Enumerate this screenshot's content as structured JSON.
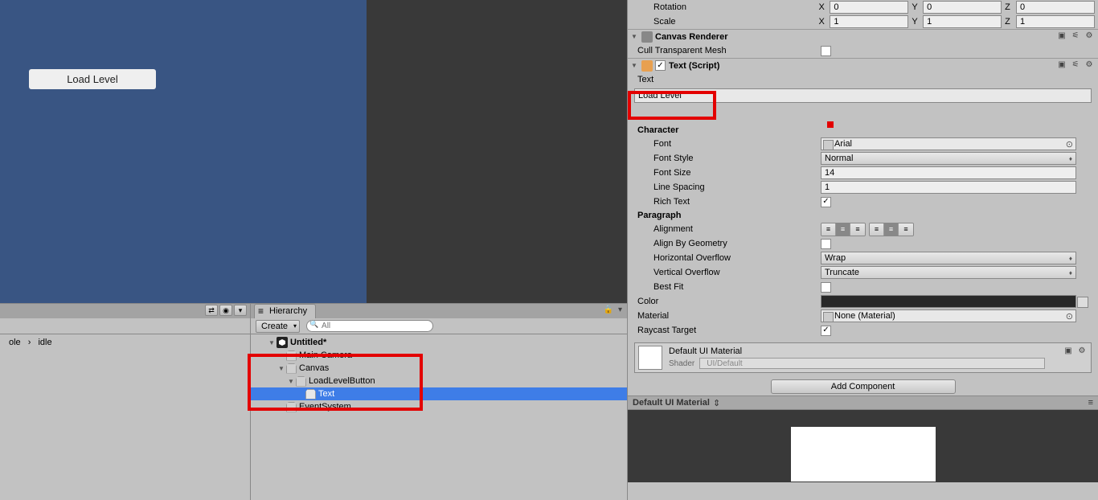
{
  "scene": {
    "button_label": "Load Level"
  },
  "bottomLeft": {
    "status_a": "ole",
    "status_b": "idle",
    "ctrl1": "⇄",
    "ctrl2": "◉",
    "menu": "▾"
  },
  "hierarchy": {
    "tab": "Hierarchy",
    "create": "Create",
    "search_placeholder": "All",
    "lockA": "🔒",
    "lockB": "▾",
    "items": {
      "scene": "Untitled*",
      "camera": "Main Camera",
      "canvas": "Canvas",
      "loadbtn": "LoadLevelButton",
      "text": "Text",
      "events": "EventSystem"
    }
  },
  "inspector": {
    "rotation": {
      "label": "Rotation",
      "x": "0",
      "y": "0",
      "z": "0"
    },
    "scale": {
      "label": "Scale",
      "x": "1",
      "y": "1",
      "z": "1"
    },
    "canvasRenderer": {
      "title": "Canvas Renderer",
      "cull_label": "Cull Transparent Mesh",
      "cull_checked": false
    },
    "textScript": {
      "title": "Text (Script)",
      "text_label": "Text",
      "text_value": "Load Level"
    },
    "character": {
      "header": "Character",
      "font_label": "Font",
      "font_value": "Arial",
      "style_label": "Font Style",
      "style_value": "Normal",
      "size_label": "Font Size",
      "size_value": "14",
      "spacing_label": "Line Spacing",
      "spacing_value": "1",
      "rich_label": "Rich Text",
      "rich_checked": true
    },
    "paragraph": {
      "header": "Paragraph",
      "align_label": "Alignment",
      "geom_label": "Align By Geometry",
      "geom_checked": false,
      "hover_label": "Horizontal Overflow",
      "hover_value": "Wrap",
      "vover_label": "Vertical Overflow",
      "vover_value": "Truncate",
      "bestfit_label": "Best Fit",
      "bestfit_checked": false
    },
    "color_label": "Color",
    "material_label": "Material",
    "material_value": "None (Material)",
    "raycast_label": "Raycast Target",
    "raycast_checked": true,
    "defaultMat": {
      "title": "Default UI Material",
      "shader_label": "Shader",
      "shader_value": "UI/Default"
    },
    "add_component": "Add Component",
    "preview_title": "Default UI Material"
  },
  "xyz": {
    "x": "X",
    "y": "Y",
    "z": "Z"
  },
  "checkmark": "✓"
}
